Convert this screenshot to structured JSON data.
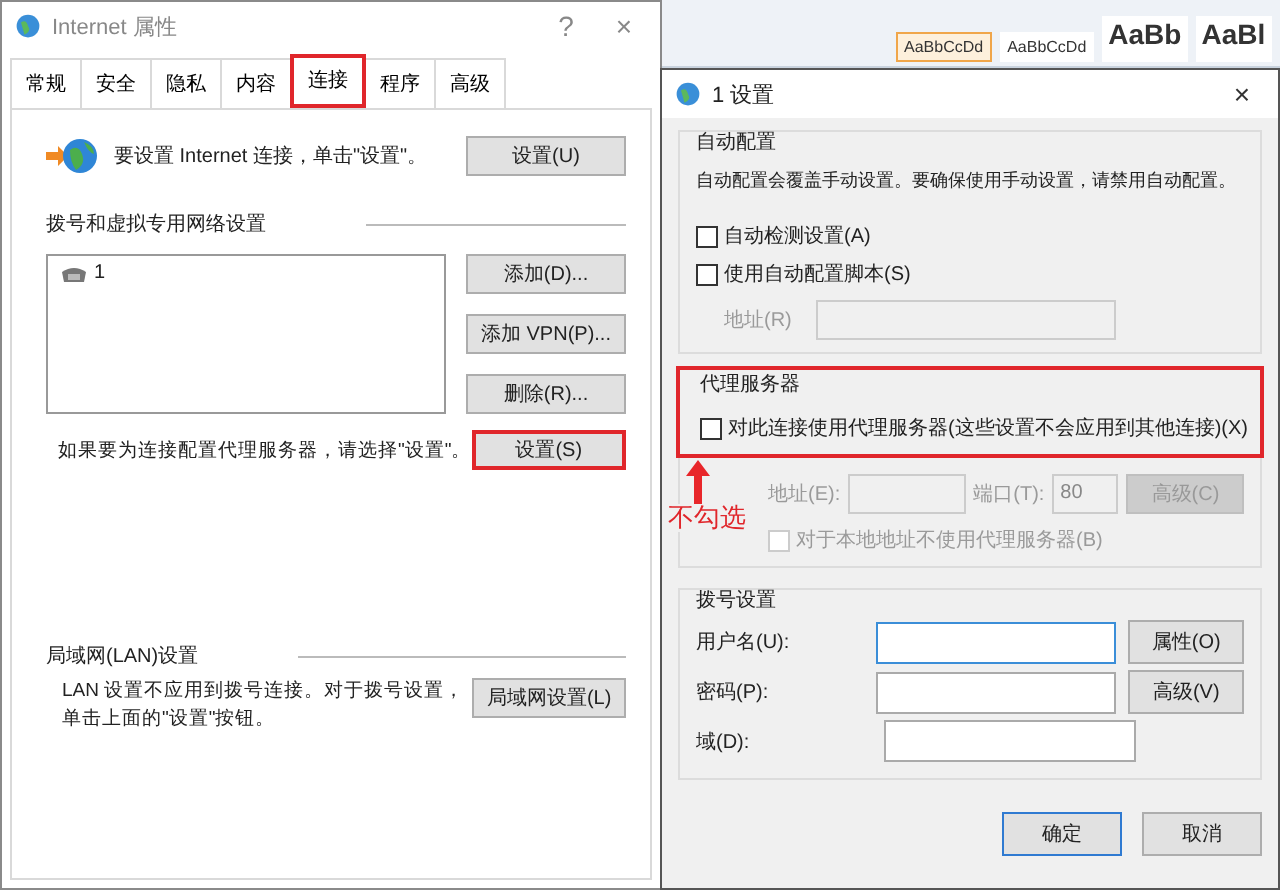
{
  "background_app": {
    "style_gallery": [
      {
        "label": "AaBbCcDd",
        "selected": true
      },
      {
        "label": "AaBbCcDd",
        "selected": false
      },
      {
        "label": "AaBb",
        "selected": false
      },
      {
        "label": "AaBl",
        "selected": false
      }
    ]
  },
  "internet_properties": {
    "title": "Internet 属性",
    "help": "?",
    "close": "×",
    "tabs": [
      {
        "label": "常规",
        "selected": false,
        "highlighted": false
      },
      {
        "label": "安全",
        "selected": false,
        "highlighted": false
      },
      {
        "label": "隐私",
        "selected": false,
        "highlighted": false
      },
      {
        "label": "内容",
        "selected": false,
        "highlighted": false
      },
      {
        "label": "连接",
        "selected": true,
        "highlighted": true
      },
      {
        "label": "程序",
        "selected": false,
        "highlighted": false
      },
      {
        "label": "高级",
        "selected": false,
        "highlighted": false
      }
    ],
    "setup": {
      "text": "要设置 Internet 连接，单击\"设置\"。",
      "button": "设置(U)"
    },
    "dialup": {
      "heading": "拨号和虚拟专用网络设置",
      "connections": [
        {
          "name": "1",
          "selected": false
        }
      ],
      "buttons": [
        "添加(D)...",
        "添加 VPN(P)...",
        "删除(R)..."
      ]
    },
    "proxy_hint": {
      "text": "如果要为连接配置代理服务器，请选择\"设置\"。",
      "button": {
        "label": "设置(S)",
        "highlighted": true
      }
    },
    "lan": {
      "heading": "局域网(LAN)设置",
      "text": "LAN 设置不应用到拨号连接。对于拨号设置，单击上面的\"设置\"按钮。",
      "button": "局域网设置(L)"
    }
  },
  "settings_dialog": {
    "title": "1 设置",
    "close": "×",
    "auto_config": {
      "heading": "自动配置",
      "text": "自动配置会覆盖手动设置。要确保使用手动设置，请禁用自动配置。",
      "options": [
        {
          "label": "自动检测设置(A)",
          "checked": false
        },
        {
          "label": "使用自动配置脚本(S)",
          "checked": false
        }
      ],
      "address": {
        "label": "地址(R)",
        "disabled": true
      }
    },
    "proxy": {
      "heading": "代理服务器",
      "highlighted": true,
      "use_proxy": {
        "label": "对此连接使用代理服务器(这些设置不会应用到其他连接)(X)",
        "checked": false
      },
      "address_label": "地址(E):",
      "port_label": "端口(T):",
      "port_value": "80",
      "advanced_button": {
        "label": "高级(C)",
        "disabled": true
      },
      "bypass_local": {
        "label": "对于本地地址不使用代理服务器(B)",
        "checked": false,
        "disabled": true
      }
    },
    "dialup": {
      "heading": "拨号设置",
      "fields": [
        {
          "label": "用户名(U):",
          "focused": true,
          "button": "属性(O)"
        },
        {
          "label": "密码(P):",
          "focused": false,
          "button": "高级(V)"
        },
        {
          "label": "域(D):",
          "focused": false
        }
      ]
    },
    "buttons": [
      {
        "label": "确定",
        "default": true
      },
      {
        "label": "取消",
        "default": false
      }
    ]
  },
  "annotation": {
    "text": "不勾选"
  }
}
